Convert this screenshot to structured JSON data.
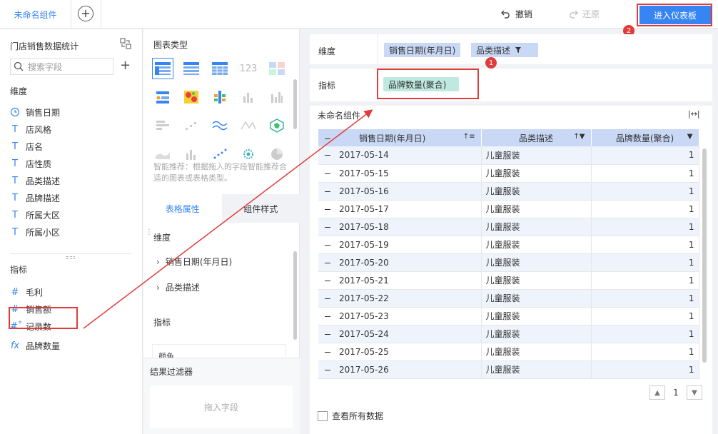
{
  "topbar": {
    "tab_name": "未命名组件",
    "add_tab": "+",
    "undo_label": "撤销",
    "redo_label": "还原",
    "enter_dashboard_label": "进入仪表板"
  },
  "left": {
    "dataset_title": "门店销售数据统计",
    "search_placeholder": "搜索字段",
    "dimension_label": "维度",
    "dimensions": [
      {
        "icon": "clock-icon",
        "label": "销售日期"
      },
      {
        "icon": "text-type-icon",
        "label": "店风格"
      },
      {
        "icon": "text-type-icon",
        "label": "店名"
      },
      {
        "icon": "text-type-icon",
        "label": "店性质"
      },
      {
        "icon": "text-type-icon",
        "label": "品类描述"
      },
      {
        "icon": "text-type-icon",
        "label": "品牌描述"
      },
      {
        "icon": "text-type-icon",
        "label": "所属大区"
      },
      {
        "icon": "text-type-icon",
        "label": "所属小区"
      }
    ],
    "measure_label": "指标",
    "measures": [
      {
        "icon": "number-type-icon",
        "label": "毛利"
      },
      {
        "icon": "number-type-icon",
        "label": "销售额"
      },
      {
        "icon": "record-count-icon",
        "label": "记录数"
      },
      {
        "icon": "calculated-field-icon",
        "label": "品牌数量"
      }
    ]
  },
  "middle": {
    "chart_type_title": "图表类型",
    "chart_types": [
      "group-table-icon",
      "detail-table-icon",
      "cross-table-icon",
      "kpi-number-icon",
      "kpi-card-icon",
      "multi-series-icon",
      "heatmap-icon",
      "cluster-icon",
      "bar-disabled-icon",
      "bar-disabled-icon",
      "horizontal-bar-disabled-icon",
      "scatter-disabled-icon",
      "line-icon",
      "radar-disabled-icon",
      "polygon-map-icon",
      "area-disabled-icon",
      "stacked-bar-disabled-icon",
      "dot-disabled-icon",
      "bubble-icon",
      "pie-disabled-icon"
    ],
    "hint_text": "智能推荐：根据拖入的字段智能推荐合适的图表或表格类型。",
    "tab_table_props": "表格属性",
    "tab_component_style": "组件样式",
    "props_dimension_label": "维度",
    "props_dimensions": [
      "销售日期(年月日)",
      "品类描述"
    ],
    "props_measure_label": "指标",
    "props_color_label": "颜色",
    "filter_title": "结果过滤器",
    "filter_drop_hint": "拖入字段"
  },
  "right": {
    "dimension_label": "维度",
    "dimension_chips": [
      "销售日期(年月日)",
      "品类描述"
    ],
    "measure_label": "指标",
    "measure_chips": [
      "品牌数量(聚合)"
    ],
    "table_title": "未命名组件",
    "columns": [
      "销售日期(年月日)",
      "品类描述",
      "品牌数量(聚合)"
    ],
    "rows": [
      {
        "date": "2017-05-14",
        "category": "儿童服装",
        "count": "1"
      },
      {
        "date": "2017-05-15",
        "category": "儿童服装",
        "count": "1"
      },
      {
        "date": "2017-05-16",
        "category": "儿童服装",
        "count": "1"
      },
      {
        "date": "2017-05-17",
        "category": "儿童服装",
        "count": "1"
      },
      {
        "date": "2017-05-18",
        "category": "儿童服装",
        "count": "1"
      },
      {
        "date": "2017-05-19",
        "category": "儿童服装",
        "count": "1"
      },
      {
        "date": "2017-05-20",
        "category": "儿童服装",
        "count": "1"
      },
      {
        "date": "2017-05-21",
        "category": "儿童服装",
        "count": "1"
      },
      {
        "date": "2017-05-22",
        "category": "儿童服装",
        "count": "1"
      },
      {
        "date": "2017-05-23",
        "category": "儿童服装",
        "count": "1"
      },
      {
        "date": "2017-05-24",
        "category": "儿童服装",
        "count": "1"
      },
      {
        "date": "2017-05-25",
        "category": "儿童服装",
        "count": "1"
      },
      {
        "date": "2017-05-26",
        "category": "儿童服装",
        "count": "1"
      }
    ],
    "current_page": "1",
    "show_all_label": "查看所有数据"
  },
  "annotations": {
    "badge_1": "1",
    "badge_2": "2",
    "annotation_color": "#e03c3c"
  },
  "colors": {
    "accent": "#3685f2",
    "dim_chip": "#c9d8f5",
    "measure_chip": "#bfe8de"
  }
}
